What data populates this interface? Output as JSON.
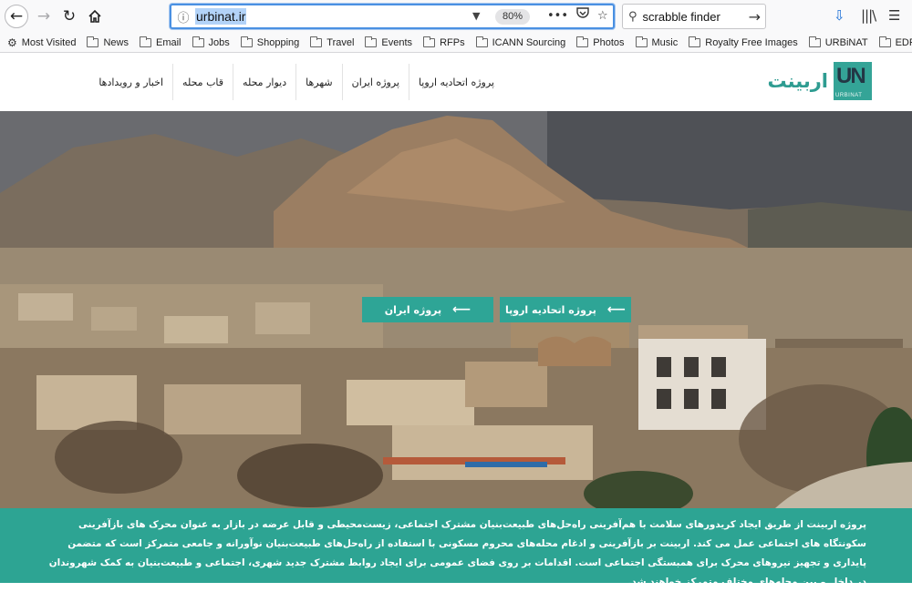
{
  "browser": {
    "url": "urbinat.ir",
    "zoom": "80%",
    "search_value": "scrabble finder",
    "bookmarks": [
      {
        "label": "Most Visited",
        "icon": "gear-icon"
      },
      {
        "label": "News",
        "icon": "folder-icon"
      },
      {
        "label": "Email",
        "icon": "folder-icon"
      },
      {
        "label": "Jobs",
        "icon": "folder-icon"
      },
      {
        "label": "Shopping",
        "icon": "folder-icon"
      },
      {
        "label": "Travel",
        "icon": "folder-icon"
      },
      {
        "label": "Events",
        "icon": "folder-icon"
      },
      {
        "label": "RFPs",
        "icon": "folder-icon"
      },
      {
        "label": "ICANN Sourcing",
        "icon": "folder-icon"
      },
      {
        "label": "Photos",
        "icon": "folder-icon"
      },
      {
        "label": "Music",
        "icon": "folder-icon"
      },
      {
        "label": "Royalty Free Images",
        "icon": "folder-icon"
      },
      {
        "label": "URBiNAT",
        "icon": "folder-icon"
      },
      {
        "label": "EDP",
        "icon": "folder-icon"
      }
    ]
  },
  "site": {
    "logo_text": "اربینت",
    "logo_mark": "UN",
    "logo_sub": "URBINAT",
    "nav": [
      "پروژه اتحادیه اروپا",
      "پروژه ایران",
      "شهرها",
      "دیوار محله",
      "قاب محله",
      "اخبار و رویدادها"
    ],
    "hero_buttons": {
      "eu": "پروژه اتحادیه اروپا",
      "iran": "پروژه ایران"
    },
    "intro": "پروژه اربینت از طریق ایجاد کریدورهای سلامت با هم‌آفرینی راه‌حل‌های طبیعت‌بنیان مشترک اجتماعی، زیست‌محیطی و قابل عرضه در بازار به عنوان محرک های بازآفرینی سکونتگاه های اجتماعی عمل می کند. اربینت بر بازآفرینی و ادغام محله‌های محروم مسکونی با استفاده از راه‌حل‌های طبیعت‌بنیان نوآورانه و جامعی متمرکز است که متضمن پایداری و تجهیز نیروهای محرک برای همبستگی اجتماعی است. اقدامات بر روی فضای عمومی برای ایجاد روابط مشترک جدید شهری، اجتماعی و طبیعت‌بنیان به کمک شهروندان در داخل و بین محله‌های مختلف متمرکز خواهند شد."
  }
}
